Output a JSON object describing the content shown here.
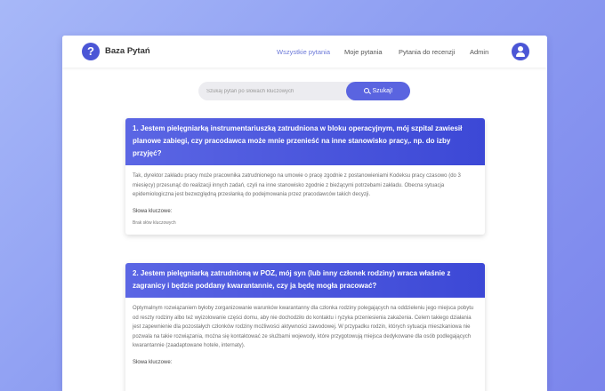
{
  "app": {
    "brand": "Baza Pytań",
    "logo_glyph": "?"
  },
  "nav": {
    "items": [
      {
        "label": "Wszystkie pytania",
        "active": true
      },
      {
        "label": "Moje pytania",
        "active": false
      },
      {
        "label": "Pytania do recenzji",
        "active": false
      },
      {
        "label": "Admin",
        "active": false
      }
    ]
  },
  "search": {
    "placeholder": "Szukaj pytań po słowach kluczowych",
    "button_label": "Szukaj!"
  },
  "questions": [
    {
      "title": "1. Jestem pielęgniarką instrumentariuszką zatrudniona w bloku operacyjnym, mój szpital zawiesił planowe zabiegi, czy pracodawca może mnie przenieść na inne stanowisko pracy,. np. do izby przyjęć?",
      "answer": "Tak, dyrektor zakładu pracy może pracownika zatrudnionego na umowie o pracę zgodnie z postanowieniami Kodeksu pracy czasowo (do 3 miesięcy) przesunąć do realizacji innych zadań, czyli na inne stanowisko zgodnie z bieżącymi potrzebami zakładu. Obecna sytuacja epidemiologiczna jest bezwzględną przesłanką do podejmowania przez pracodawców takich decyzji.",
      "keywords_label": "Słowa kluczowe:",
      "keywords_value": "Brak słów kluczowych"
    },
    {
      "title": "2. Jestem pielęgniarką zatrudnioną w POZ, mój syn (lub inny członek rodziny) wraca właśnie z zagranicy i będzie poddany kwarantannie, czy ja będę mogła pracować?",
      "answer": "Optymalnym rozwiązaniem byłoby zorganizowanie warunków kwarantanny dla członka rodziny polegających na oddzieleniu jego miejsca pobytu od reszty rodziny albo też wyizolowanie części domu, aby nie dochodziło do kontaktu i ryzyka przeniesienia zakażenia. Celem takiego działania jest zapewnienie dla pozostałych członków rodziny możliwości aktywności zawodowej. W przypadku rodzin, których sytuacja mieszkaniowa nie pozwala na takie rozwiązania, można się kontaktować ze służbami wojewody, które przygotowują miejsca dedykowane dla osób podlegających kwarantannie (zaadaptowane hotele, internaty).",
      "keywords_label": "Słowa kluczowe:",
      "keywords_value": ""
    }
  ],
  "colors": {
    "accent": "#5a64e0",
    "header_gradient_start": "#5b66e4",
    "header_gradient_end": "#3c48d6",
    "nav_active": "#6b78d8"
  },
  "icons": {
    "logo": "question-mark-icon",
    "avatar": "user-icon",
    "search": "magnifier-icon"
  }
}
